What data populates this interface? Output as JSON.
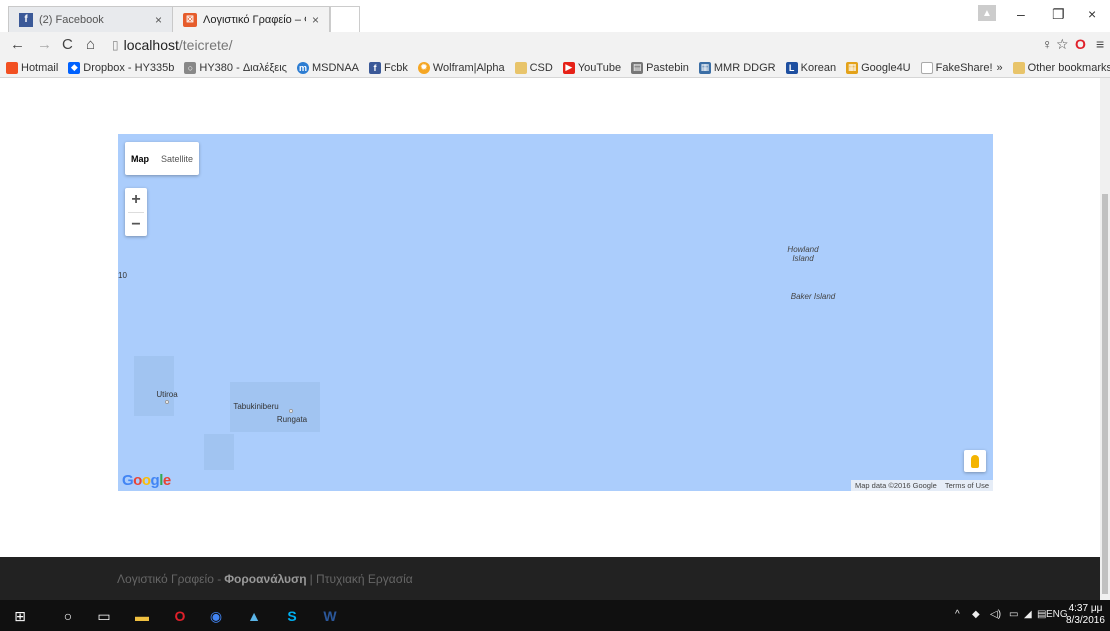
{
  "browser": {
    "tabs": [
      {
        "title": "(2) Facebook",
        "favicon": "facebook-icon"
      },
      {
        "title": "Λογιστικό Γραφείο – Φορ",
        "favicon": "site-icon"
      }
    ],
    "url_host": "localhost",
    "url_path": "/teicrete/",
    "bookmarks": [
      {
        "label": "Hotmail",
        "icon": "windows-icon",
        "color": "#f25022"
      },
      {
        "label": "Dropbox - HY335b",
        "icon": "dropbox-icon",
        "color": "#0061fe"
      },
      {
        "label": "HY380 - Διαλέξεις",
        "icon": "bird-icon",
        "color": "#888888"
      },
      {
        "label": "MSDNAA",
        "icon": "msdn-icon",
        "color": "#2d7dd2"
      },
      {
        "label": "Fcbk",
        "icon": "facebook-icon",
        "color": "#3b5998"
      },
      {
        "label": "Wolfram|Alpha",
        "icon": "wolfram-icon",
        "color": "#f5a623"
      },
      {
        "label": "CSD",
        "icon": "folder-icon",
        "color": "#e8c46a"
      },
      {
        "label": "YouTube",
        "icon": "youtube-icon",
        "color": "#e62117"
      },
      {
        "label": "Pastebin",
        "icon": "pastebin-icon",
        "color": "#777777"
      },
      {
        "label": "MMR DDGR",
        "icon": "mmr-icon",
        "color": "#3b6ea5"
      },
      {
        "label": "Korean",
        "icon": "korean-icon",
        "color": "#1e4fa0"
      },
      {
        "label": "Google4U",
        "icon": "google4u-icon",
        "color": "#e3a21a"
      },
      {
        "label": "FakeShare!",
        "icon": "page-icon",
        "color": "#aaaaaa"
      }
    ],
    "overflow_label": "»",
    "other_bookmarks": "Other bookmarks"
  },
  "map": {
    "type_map": "Map",
    "type_satellite": "Satellite",
    "zoom_in": "+",
    "zoom_out": "−",
    "labels": {
      "howland": "Howland\nIsland",
      "baker": "Baker Island",
      "edge": "10",
      "utiroa": "Utiroa",
      "tabukiniberu": "Tabukiniberu",
      "rungata": "Rungata"
    },
    "google_logo": "Google",
    "attribution": "Map data ©2016 Google",
    "terms": "Terms of Use"
  },
  "footer": {
    "prefix": "Λογιστικό Γραφείο -",
    "brand": "Φοροανάλυση",
    "suffix": "| Πτυχιακή Εργασία"
  },
  "taskbar": {
    "lang": "ENG",
    "time": "4:37 μμ",
    "date": "8/3/2016"
  }
}
